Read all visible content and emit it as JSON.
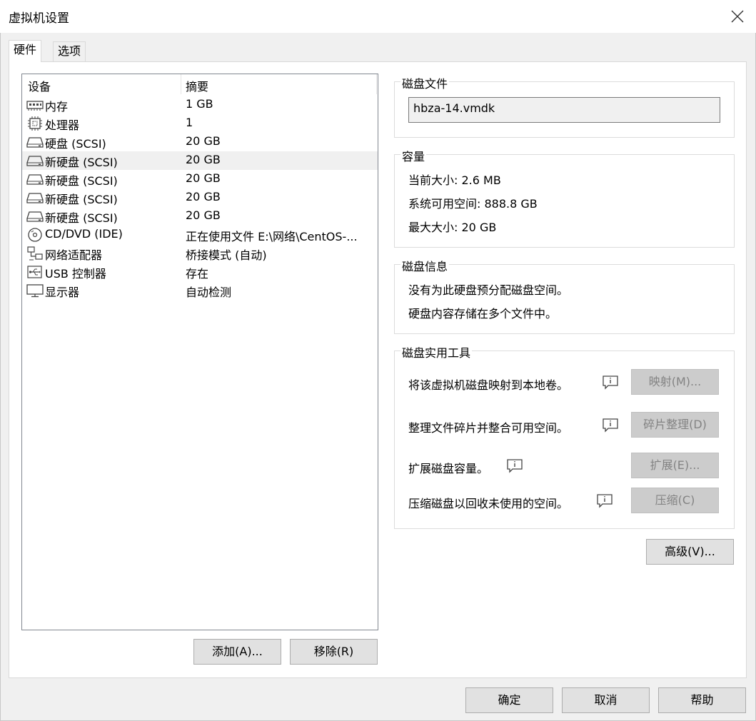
{
  "window": {
    "title": "虚拟机设置"
  },
  "tabs": [
    {
      "label": "硬件",
      "active": true
    },
    {
      "label": "选项",
      "active": false
    }
  ],
  "device_list": {
    "header_device": "设备",
    "header_summary": "摘要",
    "items": [
      {
        "name": "内存",
        "summary": "1 GB",
        "icon": "memory-icon",
        "selected": false
      },
      {
        "name": "处理器",
        "summary": "1",
        "icon": "processor-icon",
        "selected": false
      },
      {
        "name": "硬盘 (SCSI)",
        "summary": "20 GB",
        "icon": "hard-disk-icon",
        "selected": false
      },
      {
        "name": "新硬盘 (SCSI)",
        "summary": "20 GB",
        "icon": "hard-disk-icon",
        "selected": true
      },
      {
        "name": "新硬盘 (SCSI)",
        "summary": "20 GB",
        "icon": "hard-disk-icon",
        "selected": false
      },
      {
        "name": "新硬盘 (SCSI)",
        "summary": "20 GB",
        "icon": "hard-disk-icon",
        "selected": false
      },
      {
        "name": "新硬盘 (SCSI)",
        "summary": "20 GB",
        "icon": "hard-disk-icon",
        "selected": false
      },
      {
        "name": "CD/DVD (IDE)",
        "summary": "正在使用文件 E:\\网络\\CentOS-...",
        "icon": "cd-dvd-icon",
        "selected": false
      },
      {
        "name": "网络适配器",
        "summary": "桥接模式 (自动)",
        "icon": "network-adapter-icon",
        "selected": false
      },
      {
        "name": "USB 控制器",
        "summary": "存在",
        "icon": "usb-icon",
        "selected": false
      },
      {
        "name": "显示器",
        "summary": "自动检测",
        "icon": "monitor-icon",
        "selected": false
      }
    ],
    "add_button": "添加(A)...",
    "remove_button": "移除(R)"
  },
  "disk_file": {
    "legend": "磁盘文件",
    "value": "hbza-14.vmdk"
  },
  "capacity": {
    "legend": "容量",
    "current_size_label": "当前大小:",
    "current_size": "2.6 MB",
    "free_space_label": "系统可用空间:",
    "free_space": "888.8 GB",
    "max_size_label": "最大大小:",
    "max_size": "20 GB"
  },
  "disk_info": {
    "legend": "磁盘信息",
    "line1": "没有为此硬盘预分配磁盘空间。",
    "line2": "硬盘内容存储在多个文件中。"
  },
  "disk_utilities": {
    "legend": "磁盘实用工具",
    "tools": [
      {
        "label": "将该虚拟机磁盘映射到本地卷。",
        "button": "映射(M)..."
      },
      {
        "label": "整理文件碎片并整合可用空间。",
        "button": "碎片整理(D)"
      },
      {
        "label": "扩展磁盘容量。",
        "button": "扩展(E)..."
      },
      {
        "label": "压缩磁盘以回收未使用的空间。",
        "button": "压缩(C)"
      }
    ]
  },
  "advanced_button": "高级(V)...",
  "footer": {
    "ok": "确定",
    "cancel": "取消",
    "help": "帮助"
  }
}
